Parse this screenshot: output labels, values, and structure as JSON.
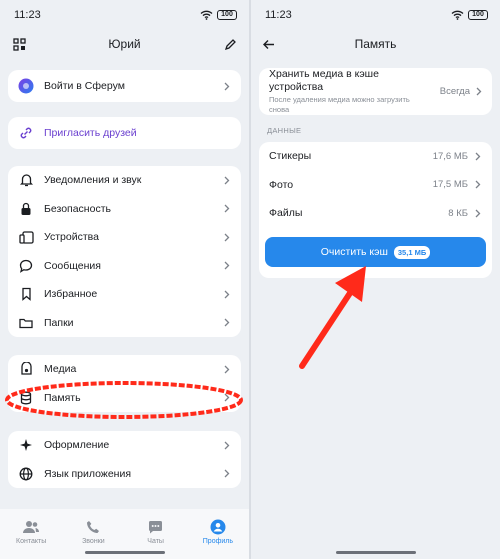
{
  "left": {
    "status": {
      "time": "11:23",
      "battery": "100"
    },
    "header": {
      "title": "Юрий"
    },
    "sferum": {
      "label": "Войти в Сферум"
    },
    "invite": {
      "label": "Пригласить друзей"
    },
    "settings": [
      {
        "label": "Уведомления и звук"
      },
      {
        "label": "Безопасность"
      },
      {
        "label": "Устройства"
      },
      {
        "label": "Сообщения"
      },
      {
        "label": "Избранное"
      },
      {
        "label": "Папки"
      }
    ],
    "storage": [
      {
        "label": "Медиа"
      },
      {
        "label": "Память"
      }
    ],
    "appearance": [
      {
        "label": "Оформление"
      },
      {
        "label": "Язык приложения"
      }
    ],
    "nav": [
      {
        "label": "Контакты"
      },
      {
        "label": "Звонки"
      },
      {
        "label": "Чаты"
      },
      {
        "label": "Профиль"
      }
    ]
  },
  "right": {
    "status": {
      "time": "11:23",
      "battery": "100"
    },
    "header": {
      "title": "Память"
    },
    "keep_media": {
      "title": "Хранить медиа в кэше устройства",
      "subtitle": "После удаления медиа можно загрузить снова",
      "value": "Всегда"
    },
    "section_title": "ДАННЫЕ",
    "data_rows": [
      {
        "label": "Стикеры",
        "value": "17,6 МБ"
      },
      {
        "label": "Фото",
        "value": "17,5 МБ"
      },
      {
        "label": "Файлы",
        "value": "8 КБ"
      }
    ],
    "clear_button": {
      "label": "Очистить кэш",
      "size": "35,1 МБ"
    }
  },
  "colors": {
    "accent": "#2688eb",
    "annotation": "#ff2a1a",
    "background": "#edf0f4",
    "invite_text": "#6a3fcf"
  }
}
